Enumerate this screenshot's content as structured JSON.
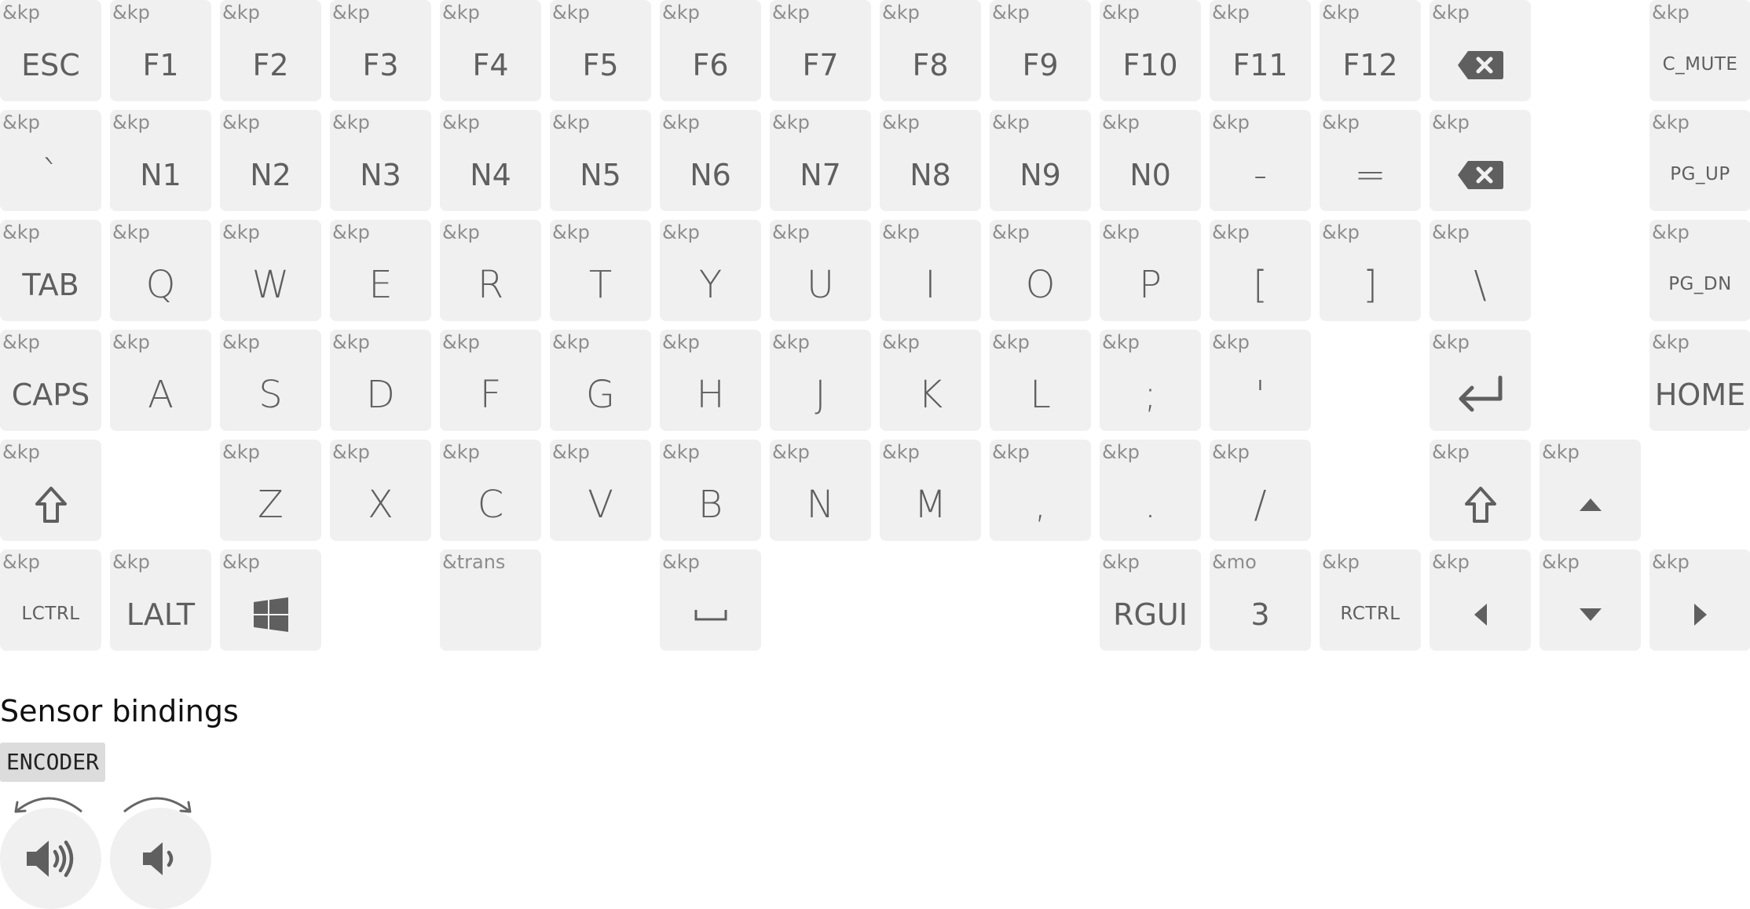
{
  "keymap": {
    "rows": [
      [
        {
          "behavior": "&kp",
          "label": "ESC",
          "style": "normal"
        },
        {
          "behavior": "&kp",
          "label": "F1",
          "style": "normal"
        },
        {
          "behavior": "&kp",
          "label": "F2",
          "style": "normal"
        },
        {
          "behavior": "&kp",
          "label": "F3",
          "style": "normal"
        },
        {
          "behavior": "&kp",
          "label": "F4",
          "style": "normal"
        },
        {
          "behavior": "&kp",
          "label": "F5",
          "style": "normal"
        },
        {
          "behavior": "&kp",
          "label": "F6",
          "style": "normal"
        },
        {
          "behavior": "&kp",
          "label": "F7",
          "style": "normal"
        },
        {
          "behavior": "&kp",
          "label": "F8",
          "style": "normal"
        },
        {
          "behavior": "&kp",
          "label": "F9",
          "style": "normal"
        },
        {
          "behavior": "&kp",
          "label": "F10",
          "style": "normal"
        },
        {
          "behavior": "&kp",
          "label": "F11",
          "style": "normal"
        },
        {
          "behavior": "&kp",
          "label": "F12",
          "style": "normal"
        },
        {
          "behavior": "&kp",
          "icon": "delete-icon"
        },
        {
          "behavior": "&kp",
          "label": "C_MUTE",
          "style": "tiny"
        }
      ],
      [
        {
          "behavior": "&kp",
          "label": "`",
          "style": "alpha"
        },
        {
          "behavior": "&kp",
          "label": "N1",
          "style": "normal"
        },
        {
          "behavior": "&kp",
          "label": "N2",
          "style": "normal"
        },
        {
          "behavior": "&kp",
          "label": "N3",
          "style": "normal"
        },
        {
          "behavior": "&kp",
          "label": "N4",
          "style": "normal"
        },
        {
          "behavior": "&kp",
          "label": "N5",
          "style": "normal"
        },
        {
          "behavior": "&kp",
          "label": "N6",
          "style": "normal"
        },
        {
          "behavior": "&kp",
          "label": "N7",
          "style": "normal"
        },
        {
          "behavior": "&kp",
          "label": "N8",
          "style": "normal"
        },
        {
          "behavior": "&kp",
          "label": "N9",
          "style": "normal"
        },
        {
          "behavior": "&kp",
          "label": "N0",
          "style": "normal"
        },
        {
          "behavior": "&kp",
          "label": "-",
          "style": "alpha"
        },
        {
          "behavior": "&kp",
          "label": "=",
          "style": "alpha"
        },
        {
          "behavior": "&kp",
          "icon": "backspace-icon"
        },
        {
          "behavior": "&kp",
          "label": "PG_UP",
          "style": "tiny"
        }
      ],
      [
        {
          "behavior": "&kp",
          "label": "TAB",
          "style": "normal"
        },
        {
          "behavior": "&kp",
          "label": "Q",
          "style": "alpha"
        },
        {
          "behavior": "&kp",
          "label": "W",
          "style": "alpha"
        },
        {
          "behavior": "&kp",
          "label": "E",
          "style": "alpha"
        },
        {
          "behavior": "&kp",
          "label": "R",
          "style": "alpha"
        },
        {
          "behavior": "&kp",
          "label": "T",
          "style": "alpha"
        },
        {
          "behavior": "&kp",
          "label": "Y",
          "style": "alpha"
        },
        {
          "behavior": "&kp",
          "label": "U",
          "style": "alpha"
        },
        {
          "behavior": "&kp",
          "label": "I",
          "style": "alpha"
        },
        {
          "behavior": "&kp",
          "label": "O",
          "style": "alpha"
        },
        {
          "behavior": "&kp",
          "label": "P",
          "style": "alpha"
        },
        {
          "behavior": "&kp",
          "label": "[",
          "style": "alpha"
        },
        {
          "behavior": "&kp",
          "label": "]",
          "style": "alpha"
        },
        {
          "behavior": "&kp",
          "label": "\\",
          "style": "alpha"
        },
        {
          "behavior": "&kp",
          "label": "PG_DN",
          "style": "tiny"
        }
      ],
      [
        {
          "behavior": "&kp",
          "label": "CAPS",
          "style": "normal"
        },
        {
          "behavior": "&kp",
          "label": "A",
          "style": "alpha"
        },
        {
          "behavior": "&kp",
          "label": "S",
          "style": "alpha"
        },
        {
          "behavior": "&kp",
          "label": "D",
          "style": "alpha"
        },
        {
          "behavior": "&kp",
          "label": "F",
          "style": "alpha"
        },
        {
          "behavior": "&kp",
          "label": "G",
          "style": "alpha"
        },
        {
          "behavior": "&kp",
          "label": "H",
          "style": "alpha"
        },
        {
          "behavior": "&kp",
          "label": "J",
          "style": "alpha"
        },
        {
          "behavior": "&kp",
          "label": "K",
          "style": "alpha"
        },
        {
          "behavior": "&kp",
          "label": "L",
          "style": "alpha"
        },
        {
          "behavior": "&kp",
          "label": ";",
          "style": "alpha"
        },
        {
          "behavior": "&kp",
          "label": "'",
          "style": "alpha"
        },
        {
          "behavior": "&kp",
          "icon": "enter-icon"
        },
        {
          "behavior": "&kp",
          "label": "HOME",
          "style": "normal"
        }
      ],
      [
        {
          "behavior": "&kp",
          "icon": "shift-icon"
        },
        {
          "behavior": "&kp",
          "label": "Z",
          "style": "alpha"
        },
        {
          "behavior": "&kp",
          "label": "X",
          "style": "alpha"
        },
        {
          "behavior": "&kp",
          "label": "C",
          "style": "alpha"
        },
        {
          "behavior": "&kp",
          "label": "V",
          "style": "alpha"
        },
        {
          "behavior": "&kp",
          "label": "B",
          "style": "alpha"
        },
        {
          "behavior": "&kp",
          "label": "N",
          "style": "alpha"
        },
        {
          "behavior": "&kp",
          "label": "M",
          "style": "alpha"
        },
        {
          "behavior": "&kp",
          "label": ",",
          "style": "alpha"
        },
        {
          "behavior": "&kp",
          "label": ".",
          "style": "alpha"
        },
        {
          "behavior": "&kp",
          "label": "/",
          "style": "alpha"
        },
        {
          "behavior": "&kp",
          "icon": "shift-icon"
        },
        {
          "behavior": "&kp",
          "icon": "arrow-up-icon"
        }
      ],
      [
        {
          "behavior": "&kp",
          "label": "LCTRL",
          "style": "tiny"
        },
        {
          "behavior": "&kp",
          "label": "LALT",
          "style": "normal"
        },
        {
          "behavior": "&kp",
          "icon": "windows-icon"
        },
        {
          "behavior": "&trans",
          "label": "",
          "style": "normal"
        },
        {
          "behavior": "&kp",
          "icon": "space-icon"
        },
        {
          "behavior": "&kp",
          "label": "RGUI",
          "style": "normal"
        },
        {
          "behavior": "&mo",
          "label": "3",
          "style": "normal"
        },
        {
          "behavior": "&kp",
          "label": "RCTRL",
          "style": "tiny"
        },
        {
          "behavior": "&kp",
          "icon": "arrow-left-icon"
        },
        {
          "behavior": "&kp",
          "icon": "arrow-down-icon"
        },
        {
          "behavior": "&kp",
          "icon": "arrow-right-icon"
        }
      ]
    ]
  },
  "sensors": {
    "title": "Sensor bindings",
    "name": "ENCODER",
    "bindings": [
      {
        "direction": "counter-clockwise",
        "icon": "volume-up-icon"
      },
      {
        "direction": "clockwise",
        "icon": "volume-down-icon"
      }
    ]
  }
}
